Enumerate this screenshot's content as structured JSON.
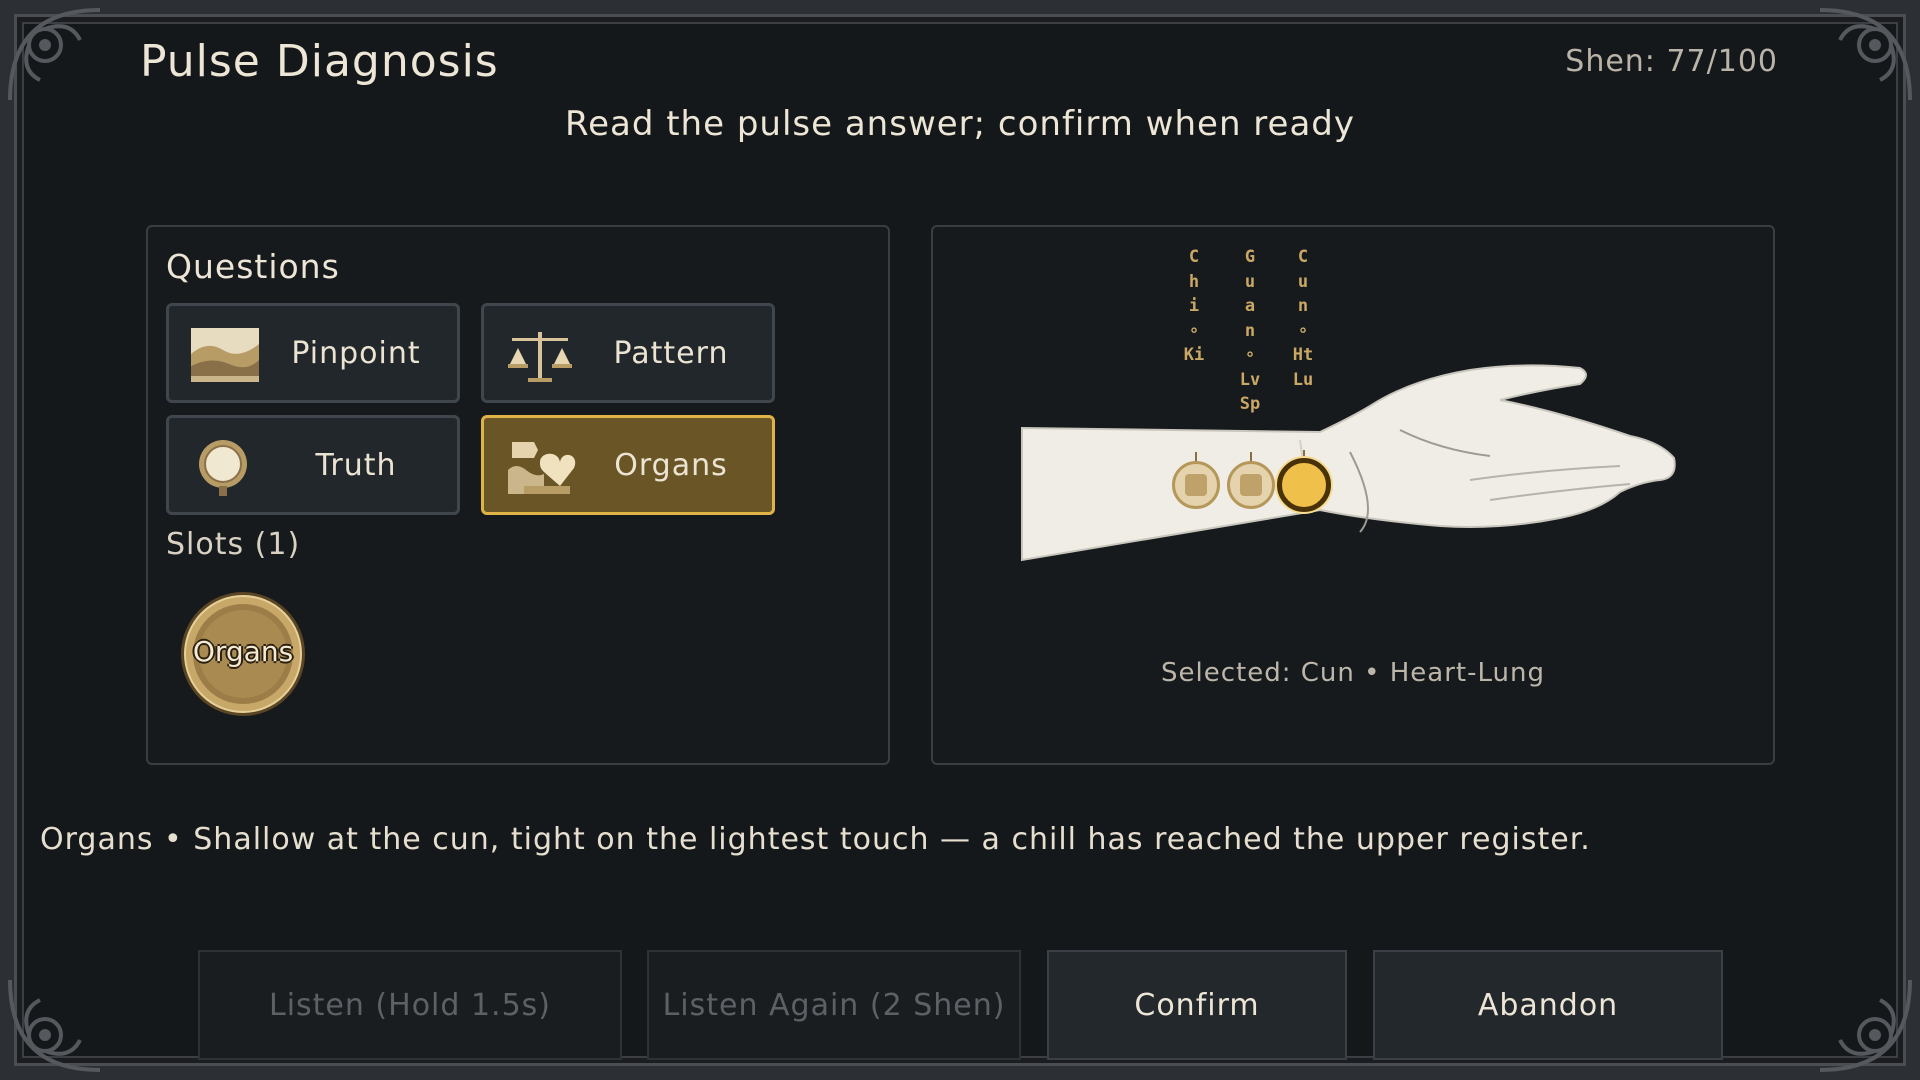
{
  "header": {
    "title": "Pulse Diagnosis",
    "shen": "Shen: 77/100",
    "instruction": "Read the pulse answer; confirm when ready"
  },
  "questions": {
    "heading": "Questions",
    "items": [
      {
        "label": "Pinpoint",
        "icon": "landscape-icon",
        "selected": false
      },
      {
        "label": "Pattern",
        "icon": "scales-icon",
        "selected": false
      },
      {
        "label": "Truth",
        "icon": "mirror-icon",
        "selected": false
      },
      {
        "label": "Organs",
        "icon": "organs-heart-icon",
        "selected": true
      }
    ],
    "slots_label": "Slots (1)",
    "slot_coin_label": "Organs"
  },
  "pulse": {
    "positions": [
      {
        "name": "Chi",
        "organs": "Ki",
        "label_glyphs": [
          "C",
          "h",
          "i",
          "∘",
          "Ki"
        ]
      },
      {
        "name": "Guan",
        "organs": "Lv Sp",
        "label_glyphs": [
          "G",
          "u",
          "a",
          "n",
          "∘",
          "Lv",
          "Sp"
        ]
      },
      {
        "name": "Cun",
        "organs": "Ht Lu",
        "label_glyphs": [
          "C",
          "u",
          "n",
          "∘",
          "Ht",
          "Lu"
        ]
      }
    ],
    "selected_index": 2,
    "selected_text": "Selected: Cun • Heart-Lung"
  },
  "answer_text": "Organs • Shallow at the cun, tight on the lightest touch — a chill has reached the upper register.",
  "actions": [
    {
      "label": "Listen (Hold 1.5s)",
      "enabled": false
    },
    {
      "label": "Listen Again (2 Shen)",
      "enabled": false
    },
    {
      "label": "Confirm",
      "enabled": true
    },
    {
      "label": "Abandon",
      "enabled": true
    }
  ],
  "colors": {
    "background": "#15181b",
    "gold_accent": "#e0b347",
    "selected_fill": "#6a5526",
    "pulse_active": "#f0c14a"
  }
}
